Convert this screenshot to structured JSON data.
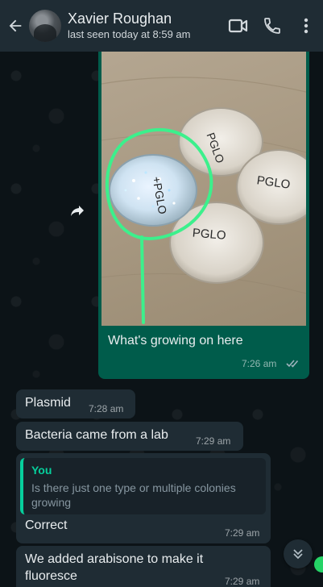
{
  "header": {
    "contact_name": "Xavier Roughan",
    "status": "last seen today at 8:59 am",
    "icons": [
      "back-arrow-icon",
      "video-call-icon",
      "phone-icon",
      "more-vertical-icon"
    ]
  },
  "messages": [
    {
      "type": "image",
      "direction": "outgoing",
      "caption": "What's growing on here",
      "time": "7:26 am",
      "read": true,
      "photo_labels": [
        "PGLO",
        "PGLO",
        "PGLO",
        "+PGLO"
      ]
    },
    {
      "type": "text",
      "direction": "incoming",
      "text": "Plasmid",
      "time": "7:28 am"
    },
    {
      "type": "text",
      "direction": "incoming",
      "text": "Bacteria came from a lab",
      "time": "7:29 am"
    },
    {
      "type": "reply",
      "direction": "incoming",
      "quote_author": "You",
      "quote_text": "Is there just one type or multiple colonies growing",
      "text": "Correct",
      "time": "7:29 am"
    },
    {
      "type": "text",
      "direction": "incoming",
      "text": "We added arabisone to make it fluoresce",
      "time": "7:29 am"
    }
  ],
  "colors": {
    "header_bg": "#1f2c34",
    "outgoing_bubble": "#005c4b",
    "incoming_bubble": "#1f2c34",
    "quote_accent": "#06cf9c",
    "annotation_green": "#3cf08c"
  }
}
